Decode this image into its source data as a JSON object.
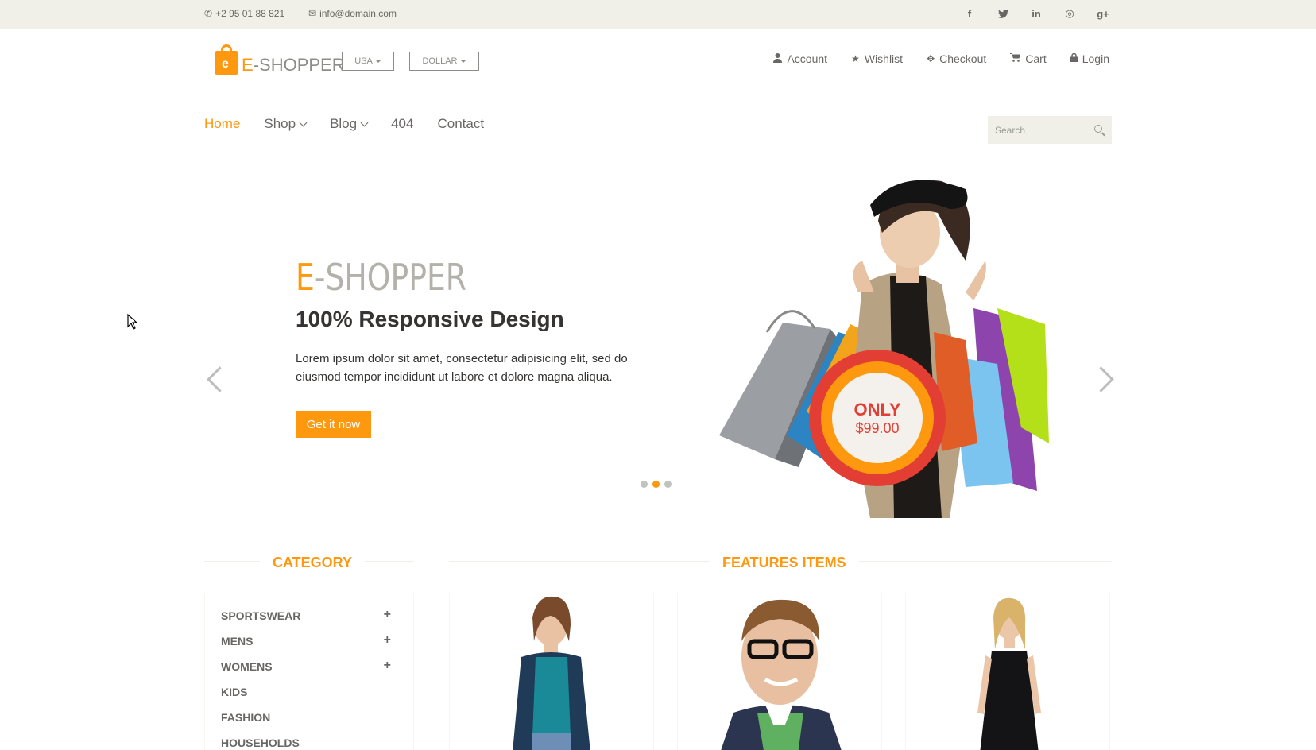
{
  "topbar": {
    "phone": "+2 95 01 88 821",
    "email": "info@domain.com",
    "social": [
      {
        "name": "facebook-icon",
        "glyph": "f"
      },
      {
        "name": "twitter-icon",
        "glyph": "t"
      },
      {
        "name": "linkedin-icon",
        "glyph": "in"
      },
      {
        "name": "dribbble-icon",
        "glyph": "◎"
      },
      {
        "name": "google-plus-icon",
        "glyph": "g+"
      }
    ]
  },
  "header": {
    "logo_e": "E",
    "logo_rest": "-SHOPPER",
    "country": "USA",
    "currency": "DOLLAR",
    "user_nav": [
      {
        "label": "Account",
        "icon": "user-icon",
        "glyph": "●"
      },
      {
        "label": "Wishlist",
        "icon": "star-icon",
        "glyph": "★"
      },
      {
        "label": "Checkout",
        "icon": "crosshairs-icon",
        "glyph": "✥"
      },
      {
        "label": "Cart",
        "icon": "cart-icon",
        "glyph": "🛒"
      },
      {
        "label": "Login",
        "icon": "lock-icon",
        "glyph": "🔒"
      }
    ]
  },
  "nav": {
    "items": [
      {
        "label": "Home",
        "active": true
      },
      {
        "label": "Shop",
        "dropdown": true
      },
      {
        "label": "Blog",
        "dropdown": true
      },
      {
        "label": "404"
      },
      {
        "label": "Contact"
      }
    ],
    "search_placeholder": "Search"
  },
  "slider": {
    "title_e": "E",
    "title_rest": "-SHOPPER",
    "subtitle": "100% Responsive Design",
    "text": "Lorem ipsum dolor sit amet, consectetur adipisicing elit, sed do eiusmod tempor incididunt ut labore et dolore magna aliqua.",
    "button": "Get it now",
    "badge_top": "ONLY",
    "badge_price": "$99.00",
    "active_slide": 2,
    "slide_count": 3
  },
  "category": {
    "title": "CATEGORY",
    "items": [
      {
        "label": "SPORTSWEAR",
        "expandable": true
      },
      {
        "label": "MENS",
        "expandable": true
      },
      {
        "label": "WOMENS",
        "expandable": true
      },
      {
        "label": "KIDS",
        "expandable": false
      },
      {
        "label": "FASHION",
        "expandable": false
      },
      {
        "label": "HOUSEHOLDS",
        "expandable": false
      }
    ]
  },
  "features": {
    "title": "FEATURES ITEMS"
  },
  "colors": {
    "accent": "#fe980f",
    "topbar_bg": "#f0f0e9",
    "text": "#696763",
    "badge_red": "#e33e34"
  }
}
